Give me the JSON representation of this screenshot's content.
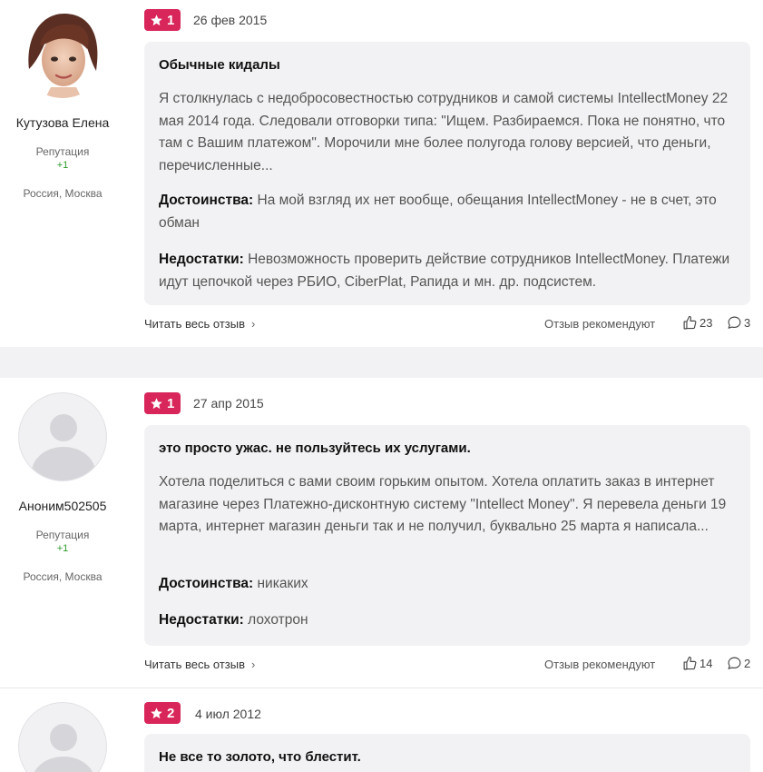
{
  "reviews": [
    {
      "author": "Кутузова Елена",
      "rep_label": "Репутация",
      "rep_value": "+1",
      "location": "Россия, Москва",
      "rating": "1",
      "date": "26 фев 2015",
      "title": "Обычные кидалы",
      "text": "Я столкнулась с недобросовестностью сотрудников и самой системы IntellectMoney 22 мая 2014 года. Следовали отговорки типа: \"Ищем. Разбираемся. Пока не понятно, что там с Вашим платежом\". Морочили мне более полугода голову версией, что деньги, перечисленные...",
      "pros_label": "Достоинства:",
      "pros": "На мой взгляд их нет вообще, обещания IntellectMoney - не в счет, это обман",
      "cons_label": "Недостатки:",
      "cons": "Невозможность проверить действие сотрудников IntellectMoney. Платежи идут цепочкой через РБИО, CiberPlat, Рапида и мн. др. подсистем.",
      "read_more": "Читать весь отзыв",
      "recommend_label": "Отзыв рекомендуют",
      "likes": "23",
      "comments": "3"
    },
    {
      "author": "Аноним502505",
      "rep_label": "Репутация",
      "rep_value": "+1",
      "location": "Россия, Москва",
      "rating": "1",
      "date": "27 апр 2015",
      "title": "это просто ужас. не пользуйтесь их услугами.",
      "text": "Хотела поделиться с вами своим горьким опытом. Хотела оплатить заказ в интернет магазине через Платежно-дисконтную систему \"Intellect Money\". Я перевела деньги 19 марта, интернет магазин деньги так и не получил, буквально 25 марта я написала...",
      "pros_label": "Достоинства:",
      "pros": "никаких",
      "cons_label": "Недостатки:",
      "cons": "лохотрон",
      "read_more": "Читать весь отзыв",
      "recommend_label": "Отзыв рекомендуют",
      "likes": "14",
      "comments": "2"
    },
    {
      "rating": "2",
      "date": "4 июл 2012",
      "title": "Не все то золото, что блестит."
    }
  ],
  "colors": {
    "rating_badge": "#d8255a",
    "card_bg": "#f2f2f4",
    "separator_bg": "#f2f2f4",
    "reputation_positive": "#2a9a2a"
  },
  "icons": {
    "rating": "star-icon",
    "read_more": "chevron-right-icon",
    "likes": "thumbs-up-icon",
    "comments": "comment-icon"
  }
}
